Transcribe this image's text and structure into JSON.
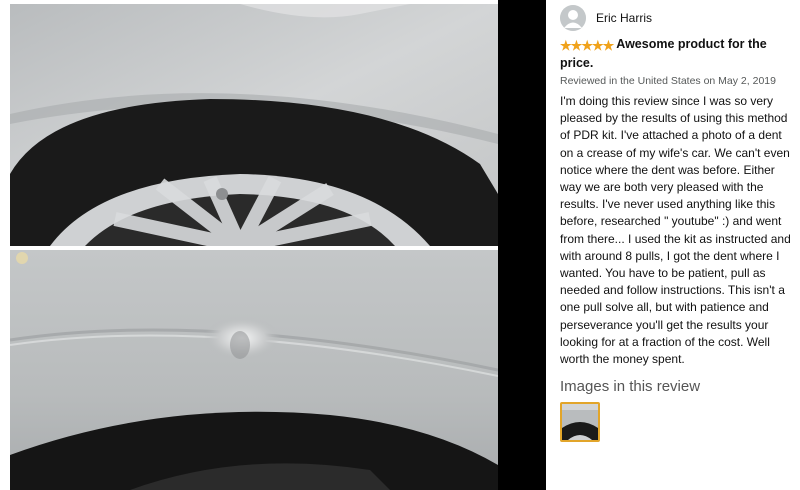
{
  "reviewer": {
    "name": "Eric Harris"
  },
  "review": {
    "rating": 5,
    "rating_max": 5,
    "title": "Awesome product for the price.",
    "meta": "Reviewed in the United States on May 2, 2019",
    "body": "I'm doing this review since I was so very pleased by the results of using this method of PDR kit. I've attached a photo of a dent on a crease of my wife's car. We can't even notice where the dent was before. Either way we are both very pleased with the results. I've never used anything like this before, researched \" youtube\" :) and went from there... I used the kit as instructed and with around 8 pulls, I got the dent where I wanted. You have to be patient, pull as needed and follow instructions. This isn't a one pull solve all, but with patience and perseverance you'll get the results your looking for at a fraction of the cost. Well worth the money spent."
  },
  "images_section": {
    "heading": "Images in this review"
  },
  "colors": {
    "star": "#f0a21b",
    "thumb_border": "#e2a52a",
    "meta_text": "#565959"
  }
}
